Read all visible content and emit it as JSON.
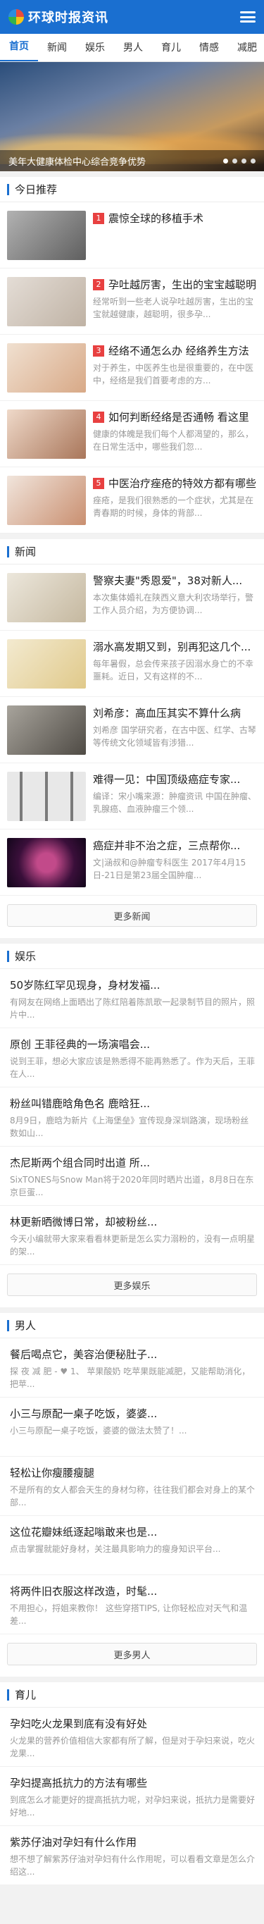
{
  "header": {
    "logo_text": "环球时报资讯"
  },
  "nav": [
    "首页",
    "新闻",
    "娱乐",
    "男人",
    "育儿",
    "情感",
    "减肥"
  ],
  "banner": {
    "title": "美年大健康体检中心综合竞争优势"
  },
  "today": {
    "title": "今日推荐",
    "items": [
      {
        "rank": "1",
        "title": "震惊全球的移植手术",
        "desc": ""
      },
      {
        "rank": "2",
        "title": "孕吐越厉害，生出的宝宝越聪明",
        "desc": "经常听到一些老人说孕吐越厉害，生出的宝宝就越健康，越聪明，很多孕..."
      },
      {
        "rank": "3",
        "title": "经络不通怎么办 经络养生方法",
        "desc": "对于养生，中医养生也是很重要的，在中医中，经络是我们首要考虑的方..."
      },
      {
        "rank": "4",
        "title": "如何判断经络是否通畅 看这里",
        "desc": "健康的体魄是我们每个人都渴望的，那么，在日常生活中，哪些我们忽..."
      },
      {
        "rank": "5",
        "title": "中医治疗痤疮的特效方都有哪些",
        "desc": "痤疮，是我们很熟悉的一个症状，尤其是在青春期的时候，身体的背部..."
      }
    ]
  },
  "news": {
    "title": "新闻",
    "items": [
      {
        "title": "警察夫妻\"秀恩爱\"，38对新人...",
        "desc": "本次集体婚礼在陕西义意大利农场举行，警工作人员介绍，为方便协调..."
      },
      {
        "title": "溺水高发期又到，别再犯这几个...",
        "desc": "每年暑假，总会传来孩子因溺水身亡的不幸噩耗。近日，又有这样的不..."
      },
      {
        "title": "刘希彦：高血压其实不算什么病",
        "desc": "刘希彦 国学研究者，在古中医、红学、古琴等传统文化领域皆有涉猎..."
      },
      {
        "title": "难得一见：中国顶级癌症专家...",
        "desc": "编译：宋小嘴来源：肿瘤资讯 中国在肿瘤、乳腺癌、血液肿瘤三个领..."
      },
      {
        "title": "癌症并非不治之症，三点帮你...",
        "desc": "文|涵叔和@肿瘤专科医生 2017年4月15日-21日是第23届全国肿瘤..."
      }
    ],
    "more": "更多新闻"
  },
  "ent": {
    "title": "娱乐",
    "items": [
      {
        "title": "50岁陈红罕见现身，身材发福...",
        "desc": "有网友在网络上面晒出了陈红陪着陈凯歌一起录制节目的照片，照片中..."
      },
      {
        "title": "原创 王菲径典的一场演唱会...",
        "desc": "说到王菲，想必大家应该是熟悉得不能再熟悉了。作为天后，王菲在人..."
      },
      {
        "title": "粉丝叫错鹿晗角色名 鹿晗狂...",
        "desc": "8月9日，鹿晗为新片《上海堡垒》宣传现身深圳路演，现场粉丝数如山..."
      },
      {
        "title": "杰尼斯两个组合同时出道 所...",
        "desc": "SixTONES与Snow Man将于2020年同时晒片出道，8月8日在东京巨蛋..."
      },
      {
        "title": "林更新晒微博日常，却被粉丝...",
        "desc": "今天小编就带大家来看看林更新是怎么实力溺粉的，没有一点明星的架..."
      }
    ],
    "more": "更多娱乐"
  },
  "men": {
    "title": "男人",
    "items": [
      {
        "title": "餐后喝点它，美容治便秘肚子...",
        "desc": "探 夜 减 肥 - ♥ 1、 苹果酸奶 吃苹果既能减肥，又能帮助消化，把苹..."
      },
      {
        "title": "小三与原配一桌子吃饭，婆婆...",
        "desc": "小三与原配一桌子吃饭，婆婆的做法太赞了！..."
      },
      {
        "title": "轻松让你瘦腰瘦腿",
        "desc": "不是所有的女人都会天生的身材匀称，往往我们都会对身上的某个部..."
      },
      {
        "title": "这位花瓣妹纸逐起嗡敢来也是...",
        "desc": "点击掌握就能好身材，关注最具影响力的瘦身知识平台..."
      },
      {
        "title": "将两件旧衣服这样改造，时髦...",
        "desc": "不用担心，捋姐来教你！ 这些穿搭TIPS, 让你轻松应对天气和温差..."
      }
    ],
    "more": "更多男人"
  },
  "kids": {
    "title": "育儿",
    "items": [
      {
        "title": "孕妇吃火龙果到底有没有好处",
        "desc": "火龙果的营养价值相信大家都有所了解，但是对于孕妇来说，吃火龙果..."
      },
      {
        "title": "孕妇提高抵抗力的方法有哪些",
        "desc": "到底怎么才能更好的提高抵抗力呢，对孕妇来说，抵抗力是需要好好地..."
      },
      {
        "title": "紫苏仔油对孕妇有什么作用",
        "desc": "想不想了解紫苏仔油对孕妇有什么作用呢，可以看看文章是怎么介绍这..."
      }
    ]
  }
}
